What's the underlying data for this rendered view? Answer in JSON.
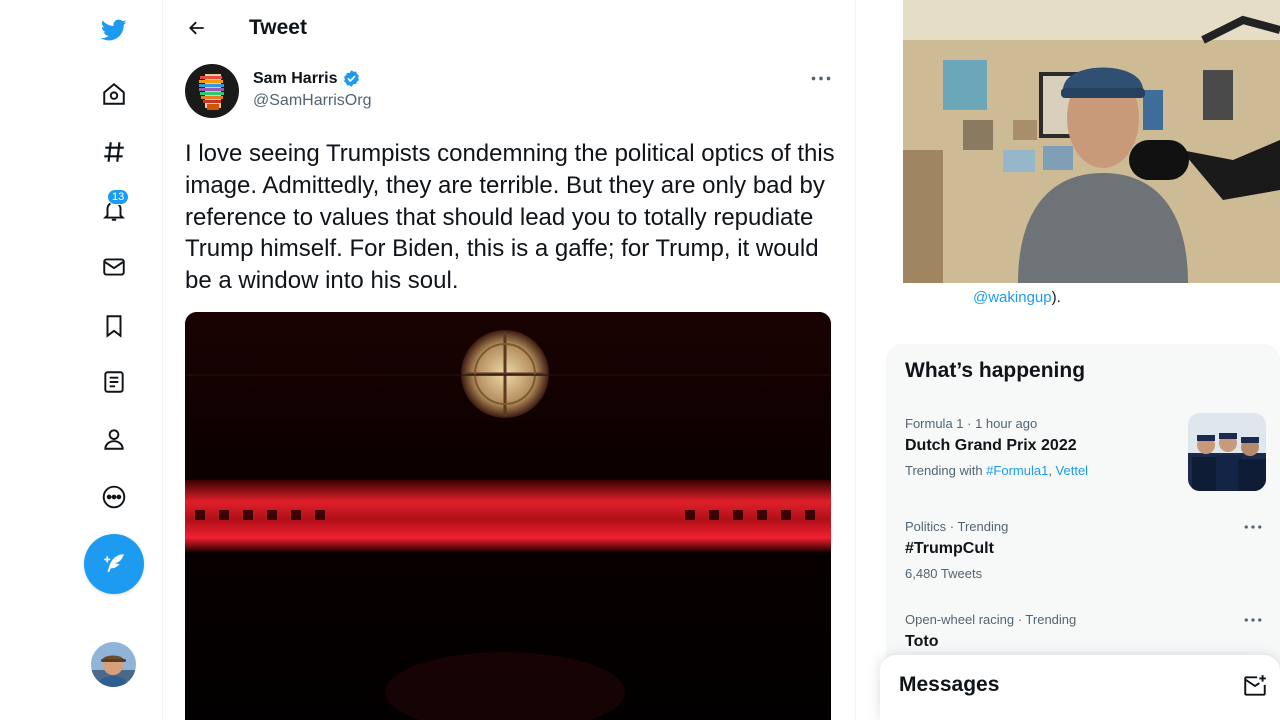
{
  "nav": {
    "notification_count": "13"
  },
  "header": {
    "title": "Tweet"
  },
  "tweet": {
    "author_name": "Sam Harris",
    "author_handle": "@SamHarrisOrg",
    "text": "I love seeing Trumpists condemning the political optics of this image. Admittedly, they are terrible. But they are only bad by reference to values that should lead you to totally repudiate Trump himself. For Biden, this is a gaffe; for Trump, it would be a window into his soul."
  },
  "sidebar": {
    "bio_link": "@wakingup",
    "bio_suffix": ").",
    "happening_title": "What’s happening",
    "trends": [
      {
        "meta": "Formula 1 · 1 hour ago",
        "title": "Dutch Grand Prix 2022",
        "sub_prefix": "Trending with ",
        "link1": "#Formula1",
        "sep": ", ",
        "link2": "Vettel"
      },
      {
        "meta": "Politics · Trending",
        "title": "#TrumpCult",
        "sub": "6,480 Tweets"
      },
      {
        "meta": "Open-wheel racing · Trending",
        "title": "Toto"
      }
    ]
  },
  "messages": {
    "title": "Messages"
  },
  "colors": {
    "accent": "#1d9bf0",
    "text": "#0f1419",
    "muted": "#536471"
  }
}
